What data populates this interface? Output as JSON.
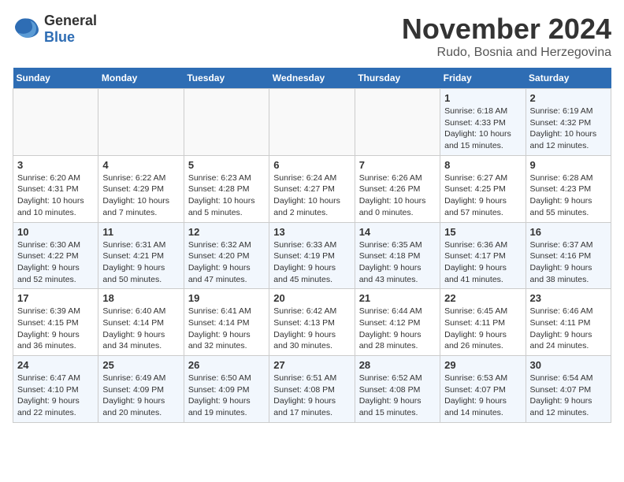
{
  "logo": {
    "general": "General",
    "blue": "Blue"
  },
  "title": "November 2024",
  "location": "Rudo, Bosnia and Herzegovina",
  "weekdays": [
    "Sunday",
    "Monday",
    "Tuesday",
    "Wednesday",
    "Thursday",
    "Friday",
    "Saturday"
  ],
  "weeks": [
    [
      {
        "day": "",
        "info": ""
      },
      {
        "day": "",
        "info": ""
      },
      {
        "day": "",
        "info": ""
      },
      {
        "day": "",
        "info": ""
      },
      {
        "day": "",
        "info": ""
      },
      {
        "day": "1",
        "info": "Sunrise: 6:18 AM\nSunset: 4:33 PM\nDaylight: 10 hours\nand 15 minutes."
      },
      {
        "day": "2",
        "info": "Sunrise: 6:19 AM\nSunset: 4:32 PM\nDaylight: 10 hours\nand 12 minutes."
      }
    ],
    [
      {
        "day": "3",
        "info": "Sunrise: 6:20 AM\nSunset: 4:31 PM\nDaylight: 10 hours\nand 10 minutes."
      },
      {
        "day": "4",
        "info": "Sunrise: 6:22 AM\nSunset: 4:29 PM\nDaylight: 10 hours\nand 7 minutes."
      },
      {
        "day": "5",
        "info": "Sunrise: 6:23 AM\nSunset: 4:28 PM\nDaylight: 10 hours\nand 5 minutes."
      },
      {
        "day": "6",
        "info": "Sunrise: 6:24 AM\nSunset: 4:27 PM\nDaylight: 10 hours\nand 2 minutes."
      },
      {
        "day": "7",
        "info": "Sunrise: 6:26 AM\nSunset: 4:26 PM\nDaylight: 10 hours\nand 0 minutes."
      },
      {
        "day": "8",
        "info": "Sunrise: 6:27 AM\nSunset: 4:25 PM\nDaylight: 9 hours\nand 57 minutes."
      },
      {
        "day": "9",
        "info": "Sunrise: 6:28 AM\nSunset: 4:23 PM\nDaylight: 9 hours\nand 55 minutes."
      }
    ],
    [
      {
        "day": "10",
        "info": "Sunrise: 6:30 AM\nSunset: 4:22 PM\nDaylight: 9 hours\nand 52 minutes."
      },
      {
        "day": "11",
        "info": "Sunrise: 6:31 AM\nSunset: 4:21 PM\nDaylight: 9 hours\nand 50 minutes."
      },
      {
        "day": "12",
        "info": "Sunrise: 6:32 AM\nSunset: 4:20 PM\nDaylight: 9 hours\nand 47 minutes."
      },
      {
        "day": "13",
        "info": "Sunrise: 6:33 AM\nSunset: 4:19 PM\nDaylight: 9 hours\nand 45 minutes."
      },
      {
        "day": "14",
        "info": "Sunrise: 6:35 AM\nSunset: 4:18 PM\nDaylight: 9 hours\nand 43 minutes."
      },
      {
        "day": "15",
        "info": "Sunrise: 6:36 AM\nSunset: 4:17 PM\nDaylight: 9 hours\nand 41 minutes."
      },
      {
        "day": "16",
        "info": "Sunrise: 6:37 AM\nSunset: 4:16 PM\nDaylight: 9 hours\nand 38 minutes."
      }
    ],
    [
      {
        "day": "17",
        "info": "Sunrise: 6:39 AM\nSunset: 4:15 PM\nDaylight: 9 hours\nand 36 minutes."
      },
      {
        "day": "18",
        "info": "Sunrise: 6:40 AM\nSunset: 4:14 PM\nDaylight: 9 hours\nand 34 minutes."
      },
      {
        "day": "19",
        "info": "Sunrise: 6:41 AM\nSunset: 4:14 PM\nDaylight: 9 hours\nand 32 minutes."
      },
      {
        "day": "20",
        "info": "Sunrise: 6:42 AM\nSunset: 4:13 PM\nDaylight: 9 hours\nand 30 minutes."
      },
      {
        "day": "21",
        "info": "Sunrise: 6:44 AM\nSunset: 4:12 PM\nDaylight: 9 hours\nand 28 minutes."
      },
      {
        "day": "22",
        "info": "Sunrise: 6:45 AM\nSunset: 4:11 PM\nDaylight: 9 hours\nand 26 minutes."
      },
      {
        "day": "23",
        "info": "Sunrise: 6:46 AM\nSunset: 4:11 PM\nDaylight: 9 hours\nand 24 minutes."
      }
    ],
    [
      {
        "day": "24",
        "info": "Sunrise: 6:47 AM\nSunset: 4:10 PM\nDaylight: 9 hours\nand 22 minutes."
      },
      {
        "day": "25",
        "info": "Sunrise: 6:49 AM\nSunset: 4:09 PM\nDaylight: 9 hours\nand 20 minutes."
      },
      {
        "day": "26",
        "info": "Sunrise: 6:50 AM\nSunset: 4:09 PM\nDaylight: 9 hours\nand 19 minutes."
      },
      {
        "day": "27",
        "info": "Sunrise: 6:51 AM\nSunset: 4:08 PM\nDaylight: 9 hours\nand 17 minutes."
      },
      {
        "day": "28",
        "info": "Sunrise: 6:52 AM\nSunset: 4:08 PM\nDaylight: 9 hours\nand 15 minutes."
      },
      {
        "day": "29",
        "info": "Sunrise: 6:53 AM\nSunset: 4:07 PM\nDaylight: 9 hours\nand 14 minutes."
      },
      {
        "day": "30",
        "info": "Sunrise: 6:54 AM\nSunset: 4:07 PM\nDaylight: 9 hours\nand 12 minutes."
      }
    ]
  ]
}
